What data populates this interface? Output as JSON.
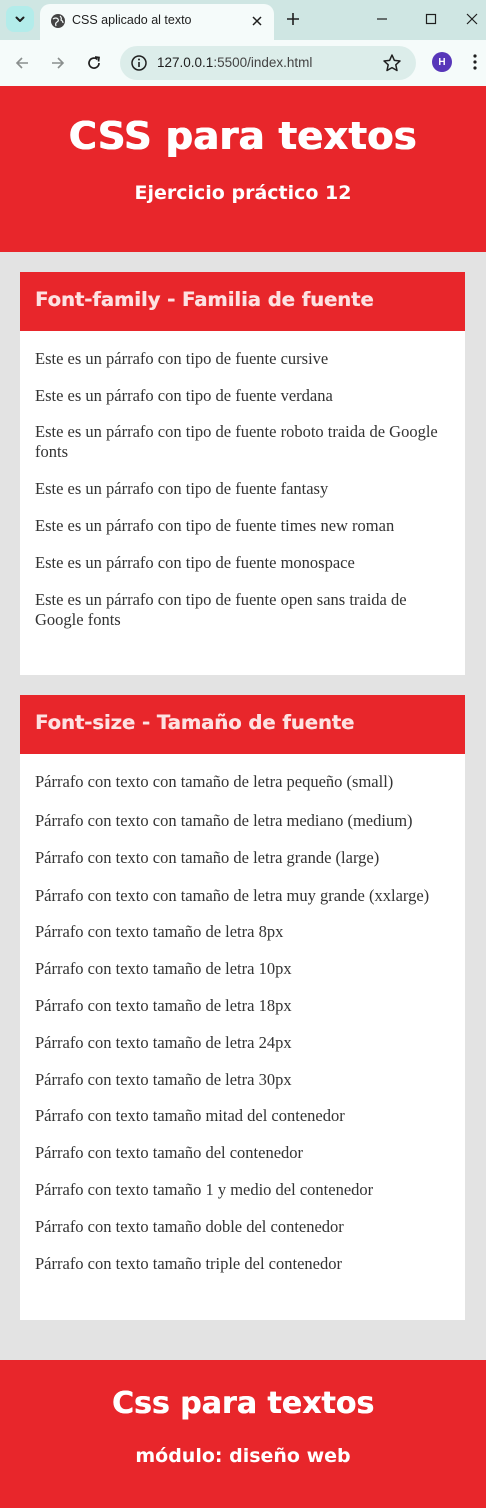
{
  "browser": {
    "tab_title": "CSS aplicado al texto",
    "url_host": "127.0.0.1",
    "url_path": ":5500/index.html",
    "profile_initial": "H",
    "icons": [
      "tab-search-icon",
      "globe-icon",
      "close-icon",
      "plus-icon",
      "minimize-icon",
      "maximize-icon",
      "window-close-icon",
      "back-icon",
      "forward-icon",
      "reload-icon",
      "info-icon",
      "star-icon",
      "kebab-menu-icon"
    ],
    "colors": {
      "tabstrip": "#cfe6e3",
      "toolbar": "#f5fbfa",
      "omnibox": "#dcedea",
      "profile": "#5736b9"
    }
  },
  "page": {
    "header": {
      "title": "CSS para textos",
      "subtitle": "Ejercicio práctico 12"
    },
    "sections": [
      {
        "heading": "Font-family - Familia de fuente",
        "paragraphs": [
          "Este es un párrafo con tipo de fuente cursive",
          "Este es un párrafo con tipo de fuente verdana",
          "Este es un párrafo con tipo de fuente roboto traida de Google fonts",
          "Este es un párrafo con tipo de fuente fantasy",
          "Este es un párrafo con tipo de fuente times new roman",
          "Este es un párrafo con tipo de fuente monospace",
          "Este es un párrafo con tipo de fuente open sans traida de Google fonts"
        ]
      },
      {
        "heading": "Font-size - Tamaño de fuente",
        "paragraphs": [
          "Párrafo con texto con tamaño de letra pequeño (small)",
          "Párrafo con texto con tamaño de letra mediano (medium)",
          "Párrafo con texto con tamaño de letra grande (large)",
          "Párrafo con texto con tamaño de letra muy grande (xxlarge)",
          "Párrafo con texto tamaño de letra 8px",
          "Párrafo con texto tamaño de letra 10px",
          "Párrafo con texto tamaño de letra 18px",
          "Párrafo con texto tamaño de letra 24px",
          "Párrafo con texto tamaño de letra 30px",
          "Párrafo con texto tamaño mitad del contenedor",
          "Párrafo con texto tamaño del contenedor",
          "Párrafo con texto tamaño 1 y medio del contenedor",
          "Párrafo con texto tamaño doble del contenedor",
          "Párrafo con texto tamaño triple del contenedor"
        ]
      }
    ],
    "footer": {
      "title": "Css para textos",
      "subtitle": "módulo: diseño web"
    },
    "colors": {
      "accent": "#e8262b",
      "background": "#e3e3e3",
      "card": "#ffffff",
      "heading_text": "#fde1e1",
      "body_text": "#333333"
    }
  }
}
